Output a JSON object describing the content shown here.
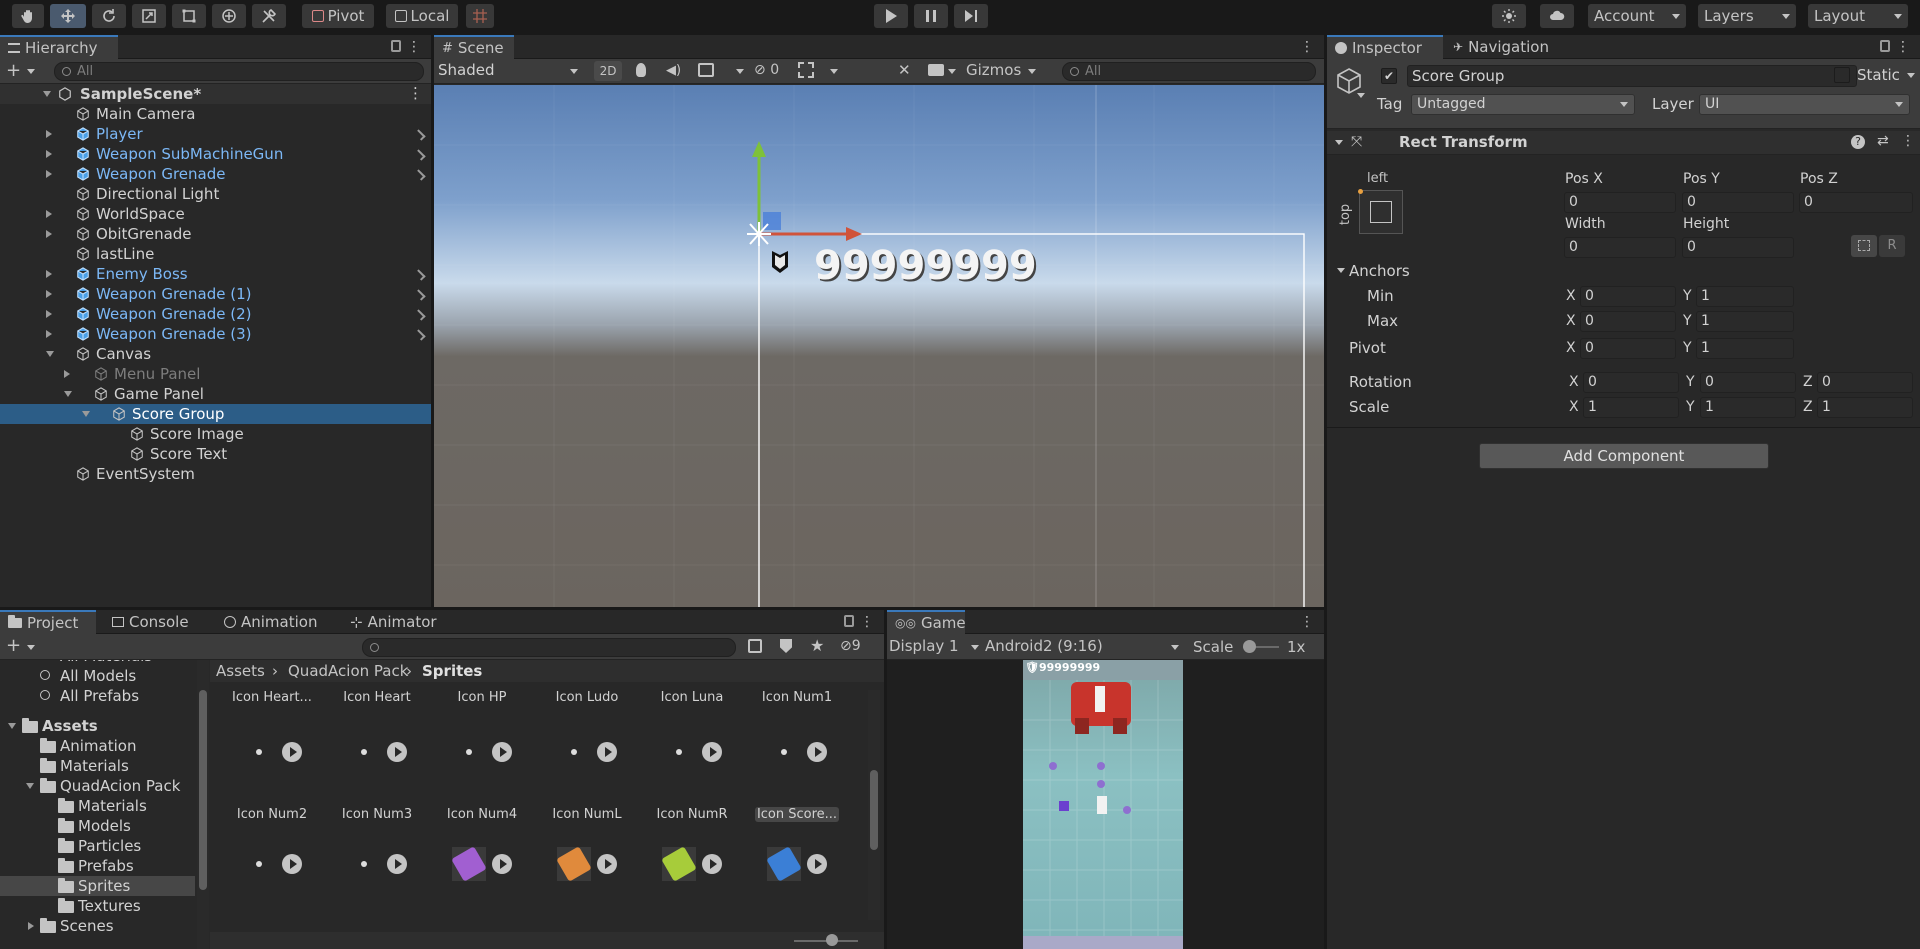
{
  "toolbar": {
    "pivot": "Pivot",
    "local": "Local",
    "account": "Account",
    "layers": "Layers",
    "layout": "Layout"
  },
  "hierarchy": {
    "tab": "Hierarchy",
    "search_placeholder": "All",
    "scene": "SampleScene*",
    "items": [
      {
        "label": "Main Camera",
        "style": "normal"
      },
      {
        "label": "Player",
        "style": "blue"
      },
      {
        "label": "Weapon SubMachineGun",
        "style": "blue"
      },
      {
        "label": "Weapon Grenade",
        "style": "blue"
      },
      {
        "label": "Directional Light",
        "style": "normal"
      },
      {
        "label": "WorldSpace",
        "style": "normal"
      },
      {
        "label": "ObitGrenade",
        "style": "normal"
      },
      {
        "label": "lastLine",
        "style": "normal"
      },
      {
        "label": "Enemy Boss",
        "style": "blue"
      },
      {
        "label": "Weapon Grenade (1)",
        "style": "blue"
      },
      {
        "label": "Weapon Grenade (2)",
        "style": "blue"
      },
      {
        "label": "Weapon Grenade (3)",
        "style": "blue"
      },
      {
        "label": "Canvas",
        "style": "normal"
      },
      {
        "label": "Menu Panel",
        "style": "dim"
      },
      {
        "label": "Game Panel",
        "style": "normal"
      },
      {
        "label": "Score Group",
        "style": "selected"
      },
      {
        "label": "Score Image",
        "style": "normal"
      },
      {
        "label": "Score Text",
        "style": "normal"
      },
      {
        "label": "EventSystem",
        "style": "normal"
      }
    ]
  },
  "scene": {
    "tab": "Scene",
    "shading": "Shaded",
    "mode_2d": "2D",
    "hidden_count": "0",
    "gizmos": "Gizmos",
    "search_placeholder": "All",
    "score_text": "99999999"
  },
  "inspector": {
    "tab": "Inspector",
    "tab2": "Navigation",
    "object_name": "Score Group",
    "static_label": "Static",
    "tag_label": "Tag",
    "tag_value": "Untagged",
    "layer_label": "Layer",
    "layer_value": "UI",
    "component": "Rect Transform",
    "anchor_h": "left",
    "anchor_v": "top",
    "pos_x_label": "Pos X",
    "pos_y_label": "Pos Y",
    "pos_z_label": "Pos Z",
    "pos_x": "0",
    "pos_y": "0",
    "pos_z": "0",
    "width_label": "Width",
    "height_label": "Height",
    "width": "0",
    "height": "0",
    "r_label": "R",
    "anchors_label": "Anchors",
    "min_label": "Min",
    "max_label": "Max",
    "min_x": "0",
    "min_y": "1",
    "max_x": "0",
    "max_y": "1",
    "pivot_label": "Pivot",
    "pivot_x": "0",
    "pivot_y": "1",
    "rotation_label": "Rotation",
    "rot_x": "0",
    "rot_y": "0",
    "rot_z": "0",
    "scale_label": "Scale",
    "scale_x": "1",
    "scale_y": "1",
    "scale_z": "1",
    "x": "X",
    "y": "Y",
    "z": "Z",
    "add_component": "Add Component"
  },
  "bottom_tabs": {
    "project": "Project",
    "console": "Console",
    "animation": "Animation",
    "animator": "Animator",
    "hidden_count": "9"
  },
  "project": {
    "search_placeholder": "",
    "tree": [
      {
        "label": "All Materials",
        "indent": 1
      },
      {
        "label": "All Models",
        "indent": 1
      },
      {
        "label": "All Prefabs",
        "indent": 1
      },
      {
        "label": "Assets",
        "indent": 0
      },
      {
        "label": "Animation",
        "indent": 1
      },
      {
        "label": "Materials",
        "indent": 1
      },
      {
        "label": "QuadAcion Pack",
        "indent": 1
      },
      {
        "label": "Materials",
        "indent": 2
      },
      {
        "label": "Models",
        "indent": 2
      },
      {
        "label": "Particles",
        "indent": 2
      },
      {
        "label": "Prefabs",
        "indent": 2
      },
      {
        "label": "Sprites",
        "indent": 2
      },
      {
        "label": "Textures",
        "indent": 2
      },
      {
        "label": "Scenes",
        "indent": 1
      }
    ],
    "breadcrumb": [
      "Assets",
      "QuadAcion Pack",
      "Sprites"
    ],
    "row1": [
      "Icon Heart...",
      "Icon Heart",
      "Icon HP",
      "Icon Ludo",
      "Icon Luna",
      "Icon Num1"
    ],
    "row2": [
      "Icon Num2",
      "Icon Num3",
      "Icon Num4",
      "Icon NumL",
      "Icon NumR",
      "Icon Score..."
    ]
  },
  "game": {
    "tab": "Game",
    "display": "Display 1",
    "aspect": "Android2 (9:16)",
    "scale_label": "Scale",
    "scale_value": "1x",
    "score": "99999999"
  },
  "colors": {
    "selection": "#2c5d87",
    "prefab_blue": "#7cb8f6",
    "sky": "#5f84b5",
    "ground": "#6f6a64"
  }
}
